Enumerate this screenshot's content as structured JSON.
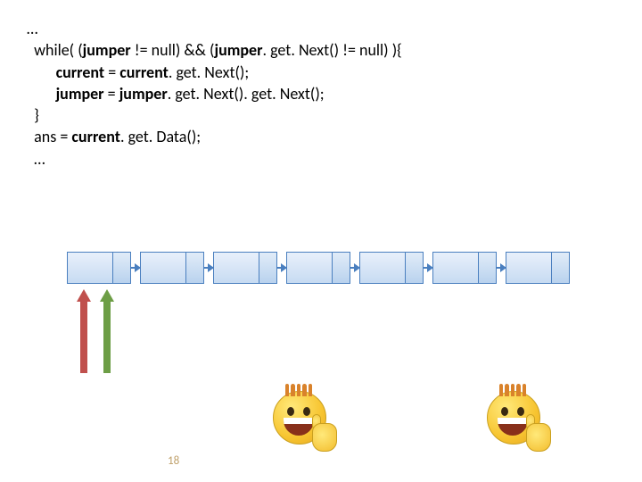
{
  "code": {
    "l1": "…",
    "l2_a": "while( (",
    "l2_b": "jumper",
    "l2_c": " != null) && (",
    "l2_d": "jumper",
    "l2_e": ". get. Next() != null) ){",
    "l3_a": "current",
    "l3_b": " = ",
    "l3_c": "current",
    "l3_d": ". get. Next();",
    "l4_a": "jumper",
    "l4_b": " = ",
    "l4_c": "jumper",
    "l4_d": ". get. Next(). get. Next();",
    "l5": "}",
    "l6_a": "ans = ",
    "l6_b": "current",
    "l6_c": ". get. Data();",
    "l7": "…"
  },
  "page_number": "18"
}
